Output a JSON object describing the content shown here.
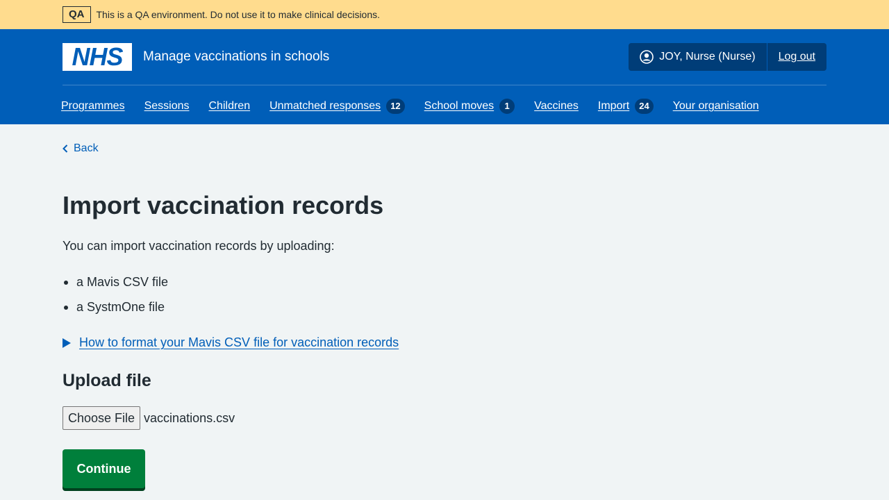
{
  "qa_banner": {
    "tag": "QA",
    "message": "This is a QA environment. Do not use it to make clinical decisions."
  },
  "header": {
    "logo_text": "NHS",
    "service_name": "Manage vaccinations in schools",
    "user_label": "JOY, Nurse (Nurse)",
    "logout_label": "Log out"
  },
  "nav": {
    "items": [
      {
        "label": "Programmes"
      },
      {
        "label": "Sessions"
      },
      {
        "label": "Children"
      },
      {
        "label": "Unmatched responses",
        "count": "12"
      },
      {
        "label": "School moves",
        "count": "1"
      },
      {
        "label": "Vaccines"
      },
      {
        "label": "Import",
        "count": "24"
      },
      {
        "label": "Your organisation"
      }
    ]
  },
  "main": {
    "back_label": "Back",
    "title": "Import vaccination records",
    "intro": "You can import vaccination records by uploading:",
    "list": [
      "a Mavis CSV file",
      "a SystmOne file"
    ],
    "details_label": "How to format your Mavis CSV file for vaccination records",
    "upload_heading": "Upload file",
    "file_button_label": "Choose File",
    "file_name": "vaccinations.csv",
    "continue_label": "Continue"
  },
  "colors": {
    "qa_banner": "#ffdc8e",
    "header_blue": "#005eb8",
    "dark_blue": "#003d78",
    "page_bg": "#f0f4f5",
    "link_blue": "#005eb8",
    "button_green": "#007f3b",
    "text": "#212b32"
  }
}
